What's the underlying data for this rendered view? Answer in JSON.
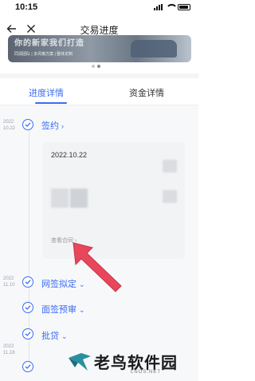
{
  "status_bar": {
    "time": "10:15"
  },
  "nav": {
    "title": "交易进度"
  },
  "banner": {
    "title": "你的新家我们打造",
    "subtitle": "同润团队 | 多风格方案 | 整体定制"
  },
  "tabs": [
    {
      "label": "进度详情",
      "active": true
    },
    {
      "label": "资金详情",
      "active": false
    }
  ],
  "timeline": [
    {
      "date": "2022\n10.22",
      "label": "签约",
      "chevron": "›"
    },
    {
      "date": "2022\n11.10",
      "label": "网签拟定",
      "chevron": "⌄"
    },
    {
      "date": "",
      "label": "面签预审",
      "chevron": "⌄"
    },
    {
      "date": "",
      "label": "批贷",
      "chevron": "⌄"
    },
    {
      "date": "2022\n11.18",
      "label": "",
      "chevron": ""
    }
  ],
  "detail": {
    "date": "2022.10.22",
    "view_contract": "查看合同 ›"
  },
  "watermark": {
    "text": "老鸟软件园",
    "domain": "LNOS.NET"
  },
  "colors": {
    "accent": "#3b6cf6",
    "arrow": "#e8475b"
  }
}
